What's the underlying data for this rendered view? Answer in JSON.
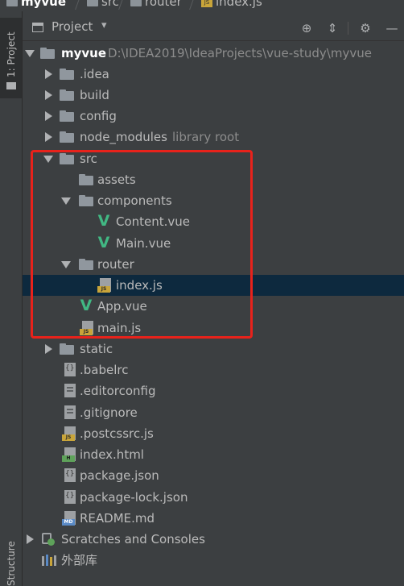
{
  "breadcrumb": {
    "items": [
      "myvue",
      "src",
      "router",
      "index.js"
    ]
  },
  "stripe": {
    "project_tab": "1: Project",
    "structure_tab": "Structure"
  },
  "header": {
    "title": "Project"
  },
  "tree": {
    "root_name": "myvue",
    "root_path": "D:\\IDEA2019\\IdeaProjects\\vue-study\\myvue",
    "items": [
      {
        "label": ".idea",
        "type": "folder"
      },
      {
        "label": "build",
        "type": "folder"
      },
      {
        "label": "config",
        "type": "folder"
      },
      {
        "label": "node_modules",
        "hint": "library root",
        "type": "folder"
      },
      {
        "label": "src",
        "type": "folder"
      },
      {
        "label": "assets",
        "type": "folder"
      },
      {
        "label": "components",
        "type": "folder"
      },
      {
        "label": "Content.vue",
        "type": "vue"
      },
      {
        "label": "Main.vue",
        "type": "vue"
      },
      {
        "label": "router",
        "type": "folder"
      },
      {
        "label": "index.js",
        "type": "js"
      },
      {
        "label": "App.vue",
        "type": "vue"
      },
      {
        "label": "main.js",
        "type": "js"
      },
      {
        "label": "static",
        "type": "folder"
      },
      {
        "label": ".babelrc",
        "type": "json"
      },
      {
        "label": ".editorconfig",
        "type": "config"
      },
      {
        "label": ".gitignore",
        "type": "config"
      },
      {
        "label": ".postcssrc.js",
        "type": "js"
      },
      {
        "label": "index.html",
        "type": "html"
      },
      {
        "label": "package.json",
        "type": "json"
      },
      {
        "label": "package-lock.json",
        "type": "json"
      },
      {
        "label": "README.md",
        "type": "md"
      },
      {
        "label": "Scratches and Consoles",
        "type": "scratch"
      },
      {
        "label": "外部库",
        "type": "library"
      }
    ]
  },
  "icons": {
    "file_tags": {
      "js": "JS",
      "html": "H",
      "md": "MD"
    },
    "vue_glyph": "V",
    "header_locate": "⊕",
    "header_collapse": "⇕",
    "header_settings": "⚙",
    "header_hide": "—",
    "header_dropdown": "▾"
  },
  "colors": {
    "background": "#3c3f41",
    "selection": "#0d293e",
    "highlight_box": "#e8221b",
    "vue_green": "#41b883",
    "js_yellow": "#c9a53a"
  }
}
